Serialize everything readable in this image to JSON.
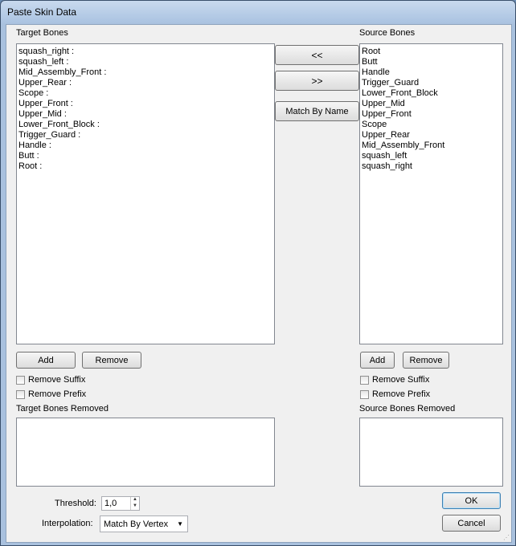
{
  "window": {
    "title": "Paste Skin Data"
  },
  "target": {
    "label": "Target Bones",
    "items": [
      "squash_right :",
      "squash_left :",
      "Mid_Assembly_Front :",
      "Upper_Rear :",
      "Scope :",
      "Upper_Front :",
      "Upper_Mid :",
      "Lower_Front_Block :",
      "Trigger_Guard :",
      "Handle :",
      "Butt :",
      "Root :"
    ],
    "add_label": "Add",
    "remove_label": "Remove",
    "remove_suffix_label": "Remove Suffix",
    "remove_prefix_label": "Remove Prefix",
    "removed_label": "Target Bones Removed"
  },
  "source": {
    "label": "Source Bones",
    "items": [
      "Root",
      "Butt",
      "Handle",
      "Trigger_Guard",
      "Lower_Front_Block",
      "Upper_Mid",
      "Upper_Front",
      "Scope",
      "Upper_Rear",
      "Mid_Assembly_Front",
      "squash_left",
      "squash_right"
    ],
    "add_label": "Add",
    "remove_label": "Remove",
    "remove_suffix_label": "Remove Suffix",
    "remove_prefix_label": "Remove Prefix",
    "removed_label": "Source Bones Removed"
  },
  "middle": {
    "left_label": "<<",
    "right_label": ">>",
    "match_label": "Match By Name"
  },
  "threshold": {
    "label": "Threshold:",
    "value": "1,0"
  },
  "interpolation": {
    "label": "Interpolation:",
    "value": "Match By Vertex"
  },
  "buttons": {
    "ok": "OK",
    "cancel": "Cancel"
  }
}
